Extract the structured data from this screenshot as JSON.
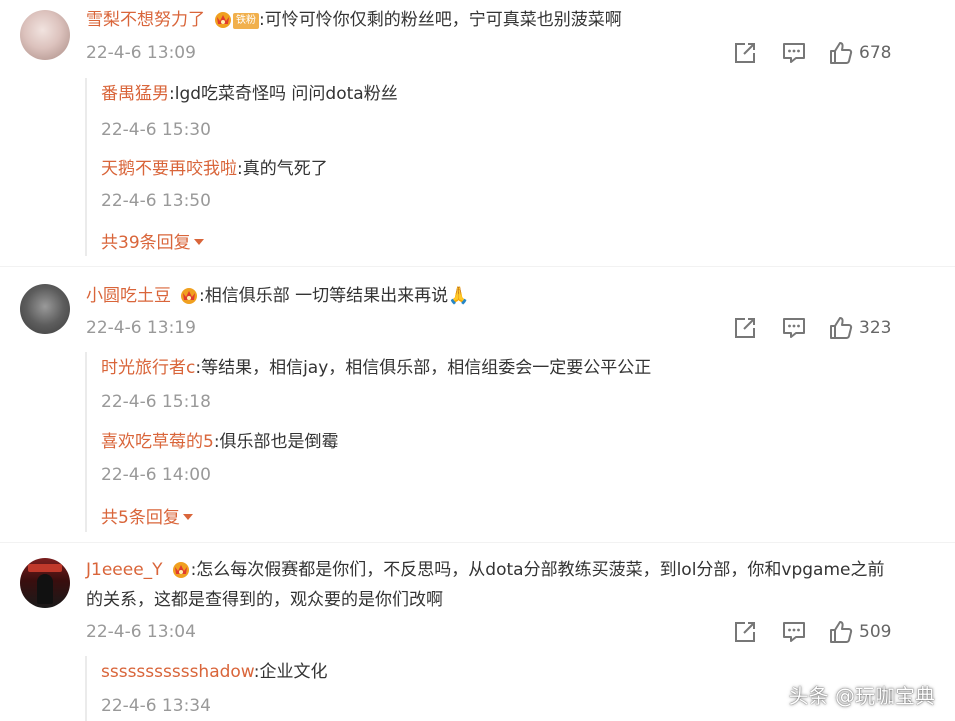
{
  "comments": [
    {
      "username": "雪梨不想努力了",
      "fan_badge": "铁粉",
      "text": ":可怜可怜你仅剩的粉丝吧，宁可真菜也别菠菜啊",
      "time": "22-4-6 13:09",
      "likes": "678",
      "replies": [
        {
          "username": "番禺猛男",
          "text": ":lgd吃菜奇怪吗 问问dota粉丝",
          "time": "22-4-6 15:30"
        },
        {
          "username": "天鹅不要再咬我啦",
          "text": ":真的气死了",
          "time": "22-4-6 13:50"
        }
      ],
      "more_replies": "共39条回复"
    },
    {
      "username": "小圆吃土豆",
      "text": ":相信俱乐部 一切等结果出来再说🙏",
      "time": "22-4-6 13:19",
      "likes": "323",
      "replies": [
        {
          "username": "时光旅行者c",
          "text": ":等结果，相信jay，相信俱乐部，相信组委会一定要公平公正",
          "time": "22-4-6 15:18"
        },
        {
          "username": "喜欢吃草莓的5",
          "text": ":俱乐部也是倒霉",
          "time": "22-4-6 14:00"
        }
      ],
      "more_replies": "共5条回复"
    },
    {
      "username": "J1eeee_Y",
      "text_line1": ":怎么每次假赛都是你们，不反思吗，从dota分部教练买菠菜，到lol分部，你和vpgame之前",
      "text_line2": "的关系，这都是查得到的，观众要的是你们改啊",
      "time": "22-4-6 13:04",
      "likes": "509",
      "replies": [
        {
          "username": "ssssssssssshadow",
          "text": ":企业文化",
          "time": "22-4-6 13:34"
        }
      ]
    }
  ],
  "watermark": "头条 @玩咖宝典",
  "icons": {
    "share": "share-icon",
    "comment": "comment-icon",
    "like": "like-icon",
    "crown": "crown-badge-icon"
  },
  "colors": {
    "username": "#d9653a",
    "time": "#999999",
    "text": "#333333"
  }
}
